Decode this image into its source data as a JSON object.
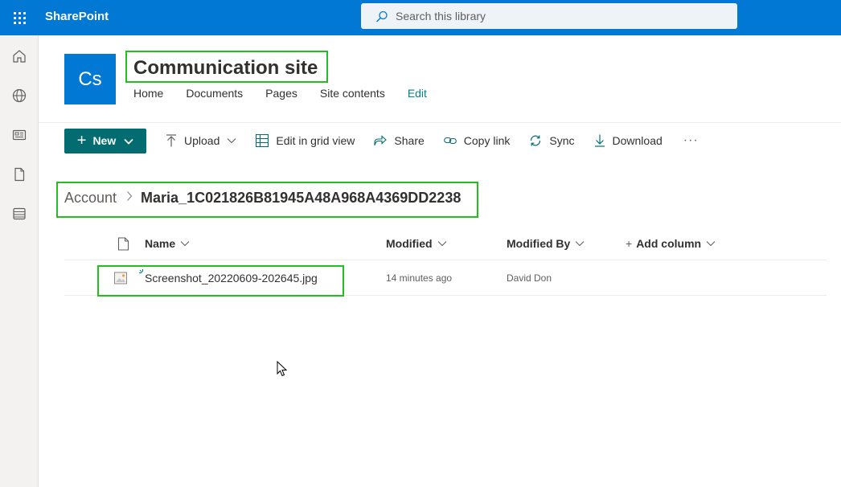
{
  "suite": {
    "app_name": "SharePoint",
    "search_placeholder": "Search this library"
  },
  "appbar": {
    "icons": [
      "home-icon",
      "globe-icon",
      "news-icon",
      "file-icon",
      "list-icon"
    ]
  },
  "site": {
    "logo_text": "Cs",
    "logo_color": "#0078d4",
    "title": "Communication site",
    "nav": [
      "Home",
      "Documents",
      "Pages",
      "Site contents",
      "Edit"
    ]
  },
  "commands": {
    "new": "New",
    "upload": "Upload",
    "grid": "Edit in grid view",
    "share": "Share",
    "copy_link": "Copy link",
    "sync": "Sync",
    "download": "Download",
    "more": "···"
  },
  "breadcrumb": {
    "root": "Account",
    "current": "Maria_1C021826B81945A48A968A4369DD2238"
  },
  "table": {
    "columns": {
      "name": "Name",
      "modified": "Modified",
      "modified_by": "Modified By",
      "add_column": "Add column"
    },
    "rows": [
      {
        "name": "Screenshot_20220609-202645.jpg",
        "modified": "14 minutes ago",
        "modified_by": "David Don"
      }
    ]
  },
  "colors": {
    "suite_bar": "#0078d4",
    "new_button": "#036c70",
    "highlight": "#22c01c",
    "edit_link": "#038387"
  }
}
